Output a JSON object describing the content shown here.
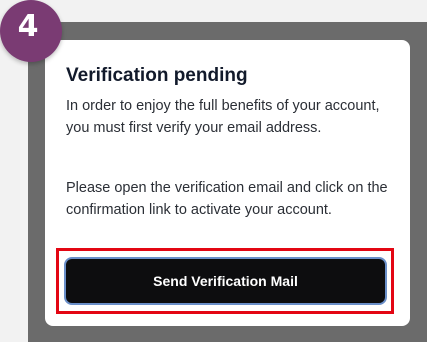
{
  "step": {
    "number": "4",
    "badge_color": "#7a3b73"
  },
  "dialog": {
    "title": "Verification pending",
    "paragraph_1": "In order to enjoy the full benefits of your account, you must first verify your email address.",
    "paragraph_2": "Please open the verification email and click on the confirmation link to activate your account.",
    "primary_button_label": "Send Verification Mail"
  },
  "colors": {
    "button_background": "#0d0d0f",
    "button_focus_ring": "#6a8fc9",
    "highlight_outline": "#e30613",
    "backdrop": "#6b6b6b"
  }
}
